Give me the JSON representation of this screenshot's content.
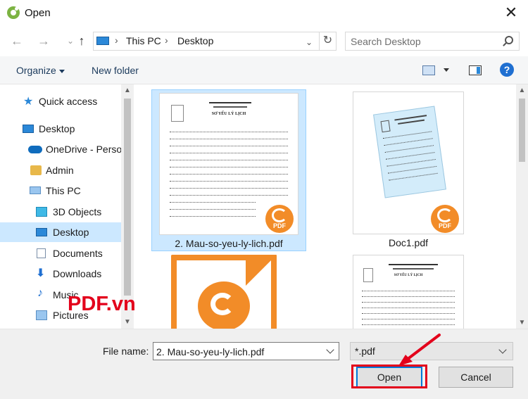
{
  "window": {
    "title": "Open",
    "icon": "foxit-app-icon",
    "close_glyph": "✕"
  },
  "address": {
    "back_glyph": "←",
    "forward_glyph": "→",
    "up_glyph": "↑",
    "crumbs": [
      "This PC",
      "Desktop"
    ],
    "separator": "›",
    "refresh_glyph": "↻",
    "search_placeholder": "Search Desktop"
  },
  "toolbar": {
    "organize_label": "Organize",
    "new_folder_label": "New folder",
    "help_glyph": "?"
  },
  "sidebar": {
    "items": [
      {
        "label": "Quick access",
        "icon": "star-icon"
      },
      {
        "label": "Desktop",
        "icon": "desktop-icon"
      },
      {
        "label": "OneDrive - Perso",
        "icon": "cloud-icon"
      },
      {
        "label": "Admin",
        "icon": "user-folder-icon"
      },
      {
        "label": "This PC",
        "icon": "computer-icon"
      },
      {
        "label": "3D Objects",
        "icon": "cube-icon"
      },
      {
        "label": "Desktop",
        "icon": "desktop-icon"
      },
      {
        "label": "Documents",
        "icon": "documents-icon"
      },
      {
        "label": "Downloads",
        "icon": "download-icon"
      },
      {
        "label": "Music",
        "icon": "music-icon"
      },
      {
        "label": "Pictures",
        "icon": "pictures-icon"
      }
    ],
    "selected_index": 6
  },
  "files": [
    {
      "name": "2. Mau-so-yeu-ly-lich.pdf",
      "selected": true
    },
    {
      "name": "Doc1.pdf",
      "selected": false
    },
    {
      "name": "",
      "selected": false
    },
    {
      "name": "",
      "selected": false
    }
  ],
  "thumb_text": {
    "doc_heading": "SƠ YẾU LÝ LỊCH",
    "pdf_badge": "PDF"
  },
  "bottom": {
    "file_name_label": "File name:",
    "file_name_value": "2. Mau-so-yeu-ly-lich.pdf",
    "file_type_value": "*.pdf",
    "open_label": "Open",
    "cancel_label": "Cancel"
  },
  "watermark": "PDF.vn",
  "colors": {
    "selection": "#cce8ff",
    "accent": "#0078d7",
    "annotation_red": "#e3001b",
    "pdf_orange": "#f28c28"
  }
}
